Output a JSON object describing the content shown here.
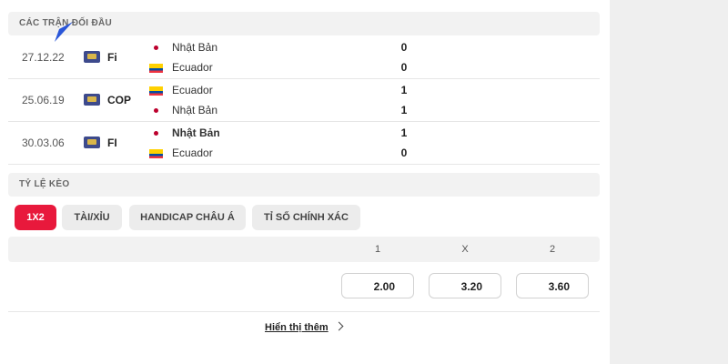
{
  "h2h": {
    "header": "CÁC TRẬN ĐỐI ĐẦU",
    "matches": [
      {
        "date": "27.12.22",
        "competition": "Fi",
        "home": {
          "name": "Nhật Bản",
          "flag": "japan",
          "score": "0",
          "winner": false
        },
        "away": {
          "name": "Ecuador",
          "flag": "ecuador",
          "score": "0",
          "winner": false
        }
      },
      {
        "date": "25.06.19",
        "competition": "COP",
        "home": {
          "name": "Ecuador",
          "flag": "ecuador",
          "score": "1",
          "winner": false
        },
        "away": {
          "name": "Nhật Bản",
          "flag": "japan",
          "score": "1",
          "winner": false
        }
      },
      {
        "date": "30.03.06",
        "competition": "FI",
        "home": {
          "name": "Nhật Bản",
          "flag": "japan",
          "score": "1",
          "winner": true
        },
        "away": {
          "name": "Ecuador",
          "flag": "ecuador",
          "score": "0",
          "winner": false
        }
      }
    ]
  },
  "odds": {
    "header": "TỶ LỆ KÈO",
    "tabs": [
      {
        "label": "1X2",
        "active": true
      },
      {
        "label": "TÀI/XỈU",
        "active": false
      },
      {
        "label": "HANDICAP CHÂU Á",
        "active": false
      },
      {
        "label": "TỈ SỐ CHÍNH XÁC",
        "active": false
      }
    ],
    "columns": [
      "1",
      "X",
      "2"
    ],
    "values": [
      "2.00",
      "3.20",
      "3.60"
    ]
  },
  "show_more": {
    "label": "Hiển thị thêm"
  },
  "colors": {
    "accent": "#e8193c",
    "section_bg": "#f2f2f2",
    "side_panel": "#efefef"
  },
  "icons": {
    "competition": "trophy-icon",
    "show_more": "chevron-right-icon",
    "pointer": "cursor-arrow-icon"
  }
}
